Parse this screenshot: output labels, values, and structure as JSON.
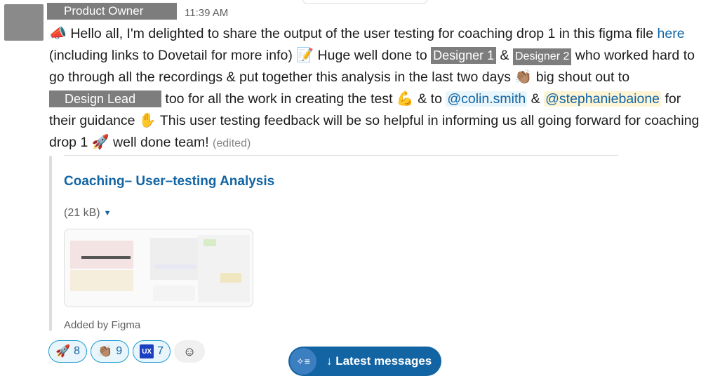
{
  "message": {
    "author": "Product Owner",
    "timestamp": "11:39 AM",
    "line1": {
      "t1": " Hello all, I'm delighted to share the output of the user testing for coaching drop 1 in this figma file ",
      "link": "here"
    },
    "line2": {
      "t1": "(including links to Dovetail for more info) ",
      "t2": " Huge well done to ",
      "designer1": "Designer 1",
      "amp": " & ",
      "designer2": "Designer 2",
      "t3": " who worked hard to"
    },
    "line3": {
      "t1": "go through all the recordings & put together this analysis in the last two days ",
      "t2": " big shout out to"
    },
    "line4": {
      "lead": "Design Lead",
      "t1": " too for all the work in creating the test ",
      "t2": " & to ",
      "mention1": "@colin.smith",
      "amp": " & ",
      "mention2": "@stephaniebaione",
      "t3": " for"
    },
    "line5": {
      "t1": "their guidance ",
      "t2": "  This user testing feedback will be so helpful in informing us all going forward for coaching"
    },
    "line6": {
      "t1": "drop 1 ",
      "t2": " well done team! ",
      "edited": "(edited)"
    }
  },
  "emojis": {
    "megaphone": "📣",
    "memo": "📝",
    "clap": "👏🏽",
    "muscle": "💪",
    "hand": "✋",
    "rocket": "🚀"
  },
  "attachment": {
    "title": "Coaching– User–testing Analysis",
    "size": "(21 kB)",
    "added_by": "Added by Figma"
  },
  "reactions": [
    {
      "emoji": "🚀",
      "count": "8"
    },
    {
      "emoji": "👏🏽",
      "count": "9"
    },
    {
      "emoji": "UX",
      "count": "7"
    }
  ],
  "add_reaction_icon": "emoji-add-icon",
  "latest_messages": {
    "label": "↓ Latest messages",
    "icon": "✧≡"
  },
  "colors": {
    "link": "#1264a3",
    "reaction_border": "#1d9bd1",
    "button": "#1264a3"
  }
}
